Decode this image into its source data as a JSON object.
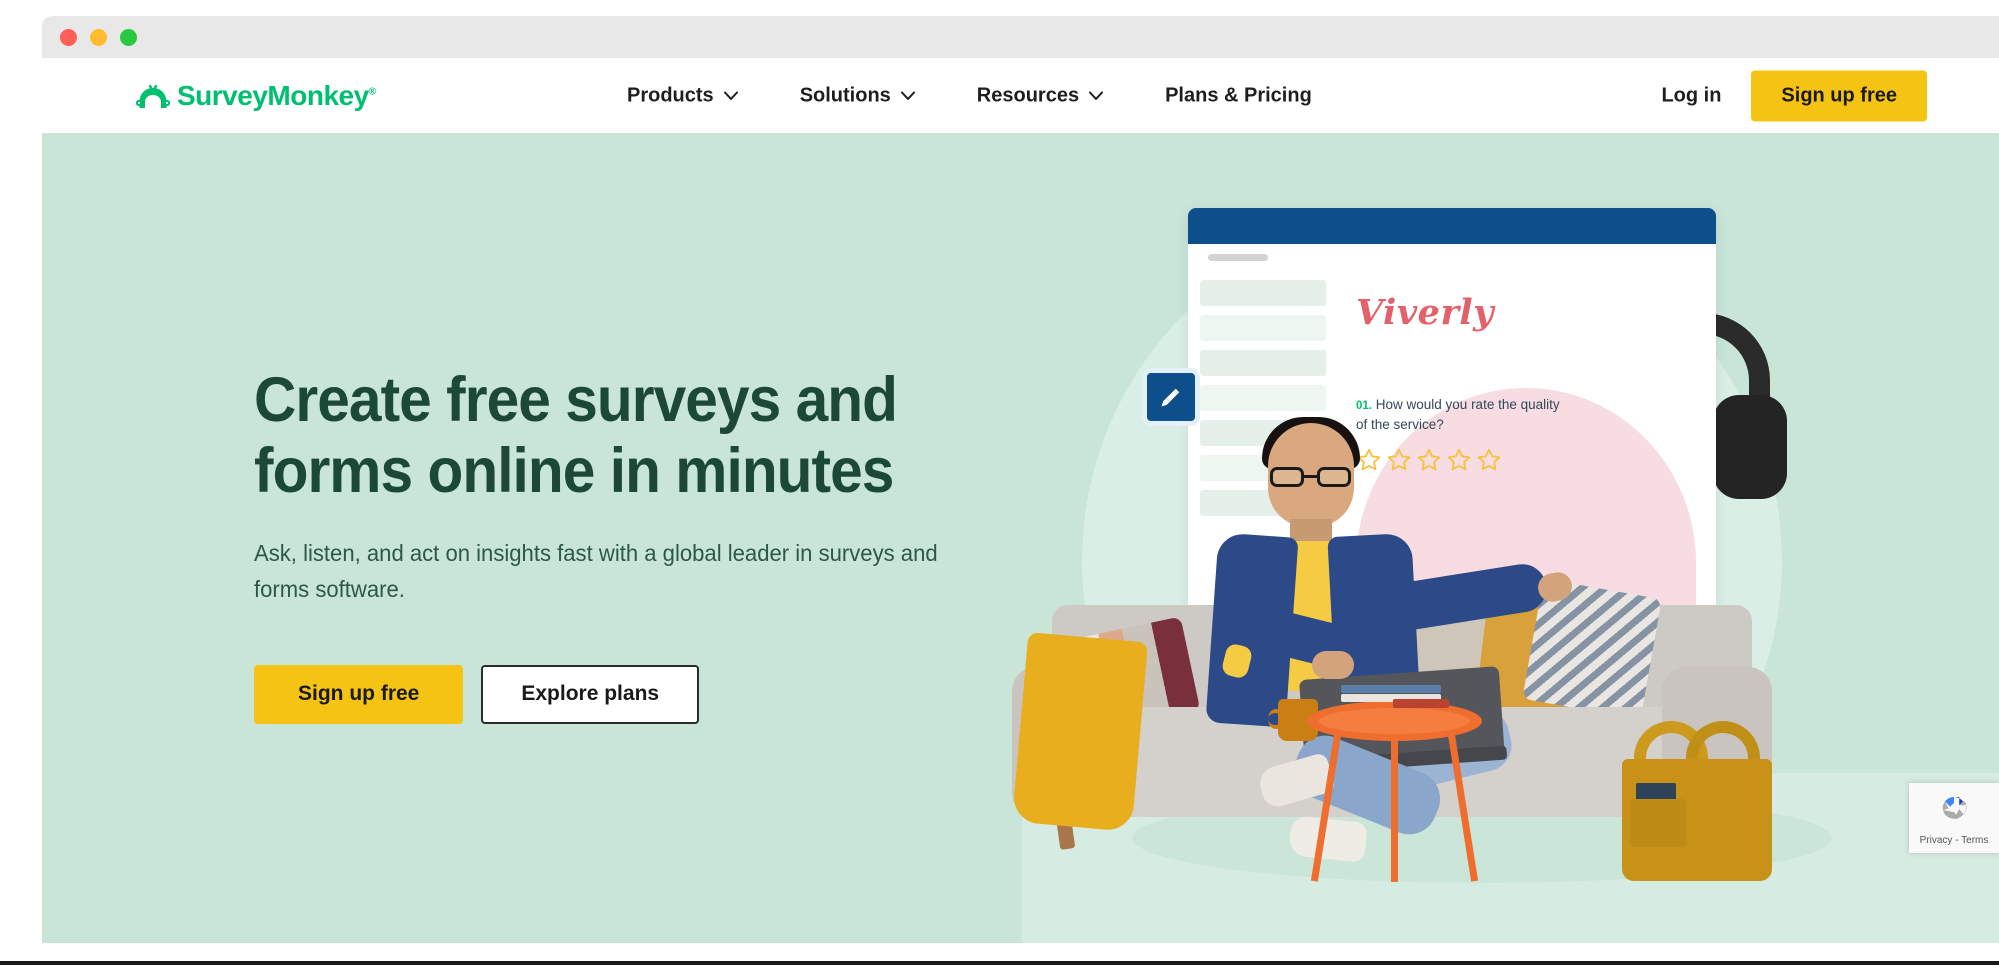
{
  "window": {
    "traffic_lights": [
      "close",
      "minimize",
      "maximize"
    ],
    "chrome_color": "#e8e8e8"
  },
  "brand": {
    "name": "SurveyMonkey",
    "name_part1": "Survey",
    "name_part2": "Monkey",
    "trademark": "®",
    "color": "#00bf6f"
  },
  "nav": {
    "items": [
      {
        "label": "Products",
        "has_dropdown": true,
        "icon": "chevron-down-icon"
      },
      {
        "label": "Solutions",
        "has_dropdown": true,
        "icon": "chevron-down-icon"
      },
      {
        "label": "Resources",
        "has_dropdown": true,
        "icon": "chevron-down-icon"
      },
      {
        "label": "Plans & Pricing",
        "has_dropdown": false,
        "icon": ""
      }
    ],
    "login_label": "Log in",
    "signup_label": "Sign up free",
    "signup_color": "#f5c313"
  },
  "hero": {
    "background_color": "#c8e5d8",
    "headline_line1": "Create free surveys and",
    "headline_line2": "forms online in minutes",
    "headline_color": "#1c4935",
    "subhead_line1": "Ask, listen, and act on insights fast with a global leader in surveys",
    "subhead_line2": "and forms software.",
    "cta_primary": "Sign up free",
    "cta_secondary": "Explore plans"
  },
  "illustration": {
    "alt": "Man on couch with laptop beside a survey preview card",
    "survey_card": {
      "brand": "Viverly",
      "brand_color": "#e4616b",
      "question_number": "01.",
      "question_text": "How would you rate the quality of the service?",
      "rating_stars": 5,
      "stars_filled": 0,
      "star_color": "#f5c33f",
      "header_color": "#0d4f8b"
    },
    "badge_icon": "pencil-icon",
    "props": [
      "headphones",
      "couch",
      "cushions",
      "yellow-blanket",
      "orange-side-table",
      "books",
      "coffee-mug",
      "mustard-tote-bag",
      "laptop"
    ]
  },
  "recaptcha": {
    "label": "Privacy - Terms",
    "icon": "recaptcha-icon"
  }
}
